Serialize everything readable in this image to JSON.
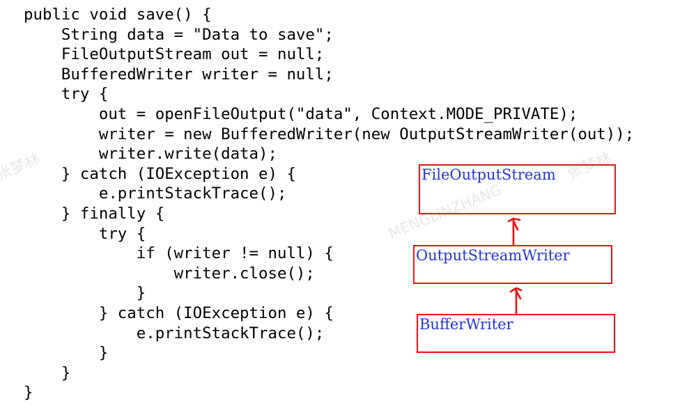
{
  "code_lines": [
    "public void save() {",
    "    String data = \"Data to save\";",
    "    FileOutputStream out = null;",
    "    BufferedWriter writer = null;",
    "    try {",
    "        out = openFileOutput(\"data\", Context.MODE_PRIVATE);",
    "        writer = new BufferedWriter(new OutputStreamWriter(out));",
    "        writer.write(data);",
    "    } catch (IOException e) {",
    "        e.printStackTrace();",
    "    } finally {",
    "        try {",
    "            if (writer != null) {",
    "                writer.close();",
    "            }",
    "        } catch (IOException e) {",
    "            e.printStackTrace();",
    "        }",
    "    }",
    "}"
  ],
  "diagram": {
    "box_top_label": "FileOutputStream",
    "box_middle_label": "OutputStreamWriter",
    "box_bottom_label": "BufferWriter",
    "box_color": "#ee1111",
    "label_color": "#2233dd"
  },
  "watermark": {
    "text_cn": "张梦林",
    "text_latin": "MENGLINZHANG"
  }
}
